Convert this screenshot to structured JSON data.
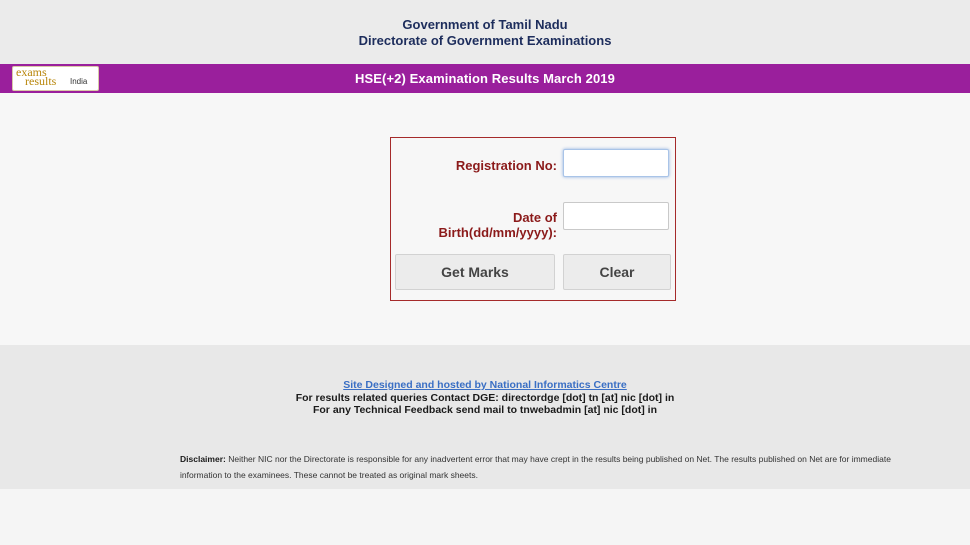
{
  "header": {
    "government": "Government of Tamil Nadu",
    "directorate": "Directorate of Government Examinations"
  },
  "banner": {
    "title": "HSE(+2)  Examination Results  March 2019",
    "logo_line1": "exams",
    "logo_line2": "results",
    "logo_line3": "India",
    "color": "#9a1f9c"
  },
  "form": {
    "registration_label": "Registration No:",
    "registration_value": "",
    "dob_label": "Date of Birth(dd/mm/yyyy):",
    "dob_value": "",
    "get_marks_label": "Get Marks",
    "clear_label": "Clear",
    "border_color": "#a52a2a",
    "label_color": "#8b1a1a"
  },
  "footer": {
    "nic_link": "Site Designed and hosted by National Informatics Centre",
    "contact": "For results related queries Contact DGE:  directordge [dot] tn [at] nic [dot] in",
    "feedback": "For any Technical Feedback send mail to tnwebadmin [at] nic [dot] in",
    "disclaimer_label": "Disclaimer:",
    "disclaimer_text": " Neither NIC nor the Directorate is responsible for any inadvertent error that may have crept in the results being published on Net. The results published on Net are for immediate information to the examinees. These cannot be treated as original mark sheets."
  }
}
